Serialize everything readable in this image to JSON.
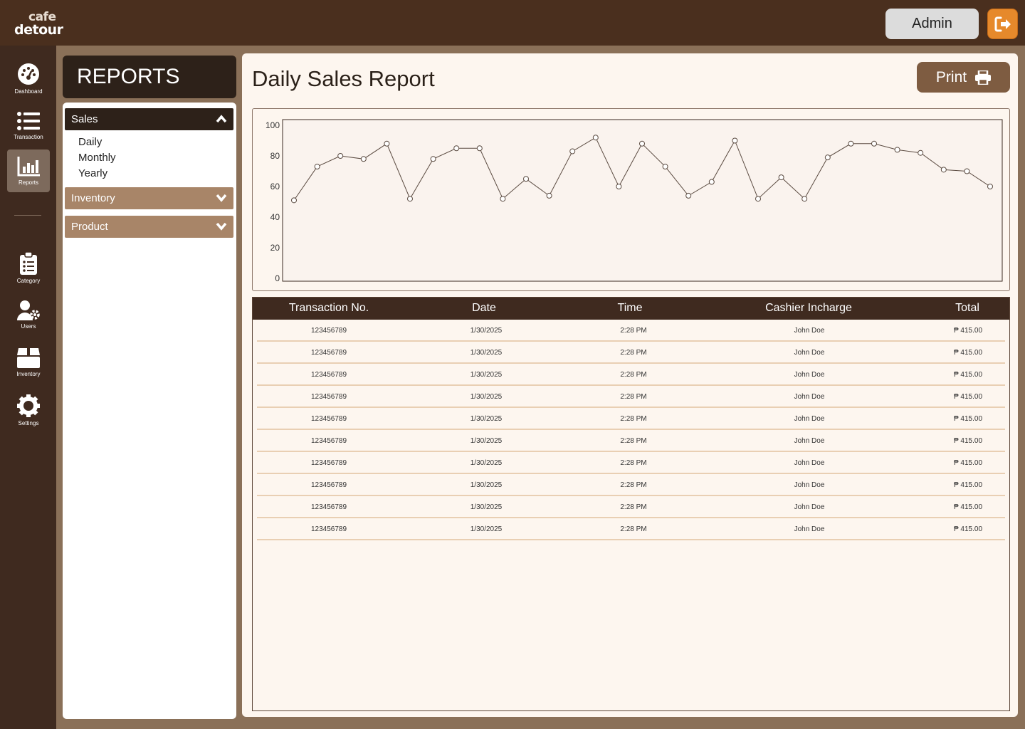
{
  "brand": {
    "line1": "cafe",
    "line2": "detour"
  },
  "header": {
    "admin_label": "Admin"
  },
  "sidebar": {
    "items": [
      {
        "label": "Dashboard"
      },
      {
        "label": "Transaction"
      },
      {
        "label": "Reports"
      },
      {
        "label": "Category"
      },
      {
        "label": "Users"
      },
      {
        "label": "Inventory"
      },
      {
        "label": "Settings"
      }
    ]
  },
  "reports_panel": {
    "title": "REPORTS",
    "sections": [
      {
        "label": "Sales",
        "expanded": true,
        "children": [
          "Daily",
          "Monthly",
          "Yearly"
        ]
      },
      {
        "label": "Inventory",
        "expanded": false
      },
      {
        "label": "Product",
        "expanded": false
      }
    ]
  },
  "main": {
    "title": "Daily Sales Report",
    "print_label": "Print"
  },
  "chart_data": {
    "type": "line",
    "title": "",
    "xlabel": "",
    "ylabel": "",
    "ylim": [
      0,
      100
    ],
    "yticks": [
      0,
      20,
      40,
      60,
      80,
      100
    ],
    "grid": false,
    "values": [
      51,
      73,
      80,
      78,
      88,
      52,
      78,
      85,
      85,
      52,
      65,
      54,
      83,
      92,
      60,
      88,
      73,
      54,
      63,
      90,
      52,
      66,
      52,
      79,
      88,
      88,
      84,
      82,
      71,
      70,
      60
    ]
  },
  "table": {
    "columns": [
      "Transaction No.",
      "Date",
      "Time",
      "Cashier Incharge",
      "Total"
    ],
    "rows": [
      [
        "123456789",
        "1/30/2025",
        "2:28 PM",
        "John Doe",
        "₱ 415.00"
      ],
      [
        "123456789",
        "1/30/2025",
        "2:28 PM",
        "John Doe",
        "₱ 415.00"
      ],
      [
        "123456789",
        "1/30/2025",
        "2:28 PM",
        "John Doe",
        "₱ 415.00"
      ],
      [
        "123456789",
        "1/30/2025",
        "2:28 PM",
        "John Doe",
        "₱ 415.00"
      ],
      [
        "123456789",
        "1/30/2025",
        "2:28 PM",
        "John Doe",
        "₱ 415.00"
      ],
      [
        "123456789",
        "1/30/2025",
        "2:28 PM",
        "John Doe",
        "₱ 415.00"
      ],
      [
        "123456789",
        "1/30/2025",
        "2:28 PM",
        "John Doe",
        "₱ 415.00"
      ],
      [
        "123456789",
        "1/30/2025",
        "2:28 PM",
        "John Doe",
        "₱ 415.00"
      ],
      [
        "123456789",
        "1/30/2025",
        "2:28 PM",
        "John Doe",
        "₱ 415.00"
      ],
      [
        "123456789",
        "1/30/2025",
        "2:28 PM",
        "John Doe",
        "₱ 415.00"
      ]
    ]
  },
  "colors": {
    "topbar": "#4a2f1e",
    "sidebar": "#3f2a1f",
    "accent": "#e6892b",
    "card": "#fdf6ef",
    "button": "#7e5c41"
  }
}
